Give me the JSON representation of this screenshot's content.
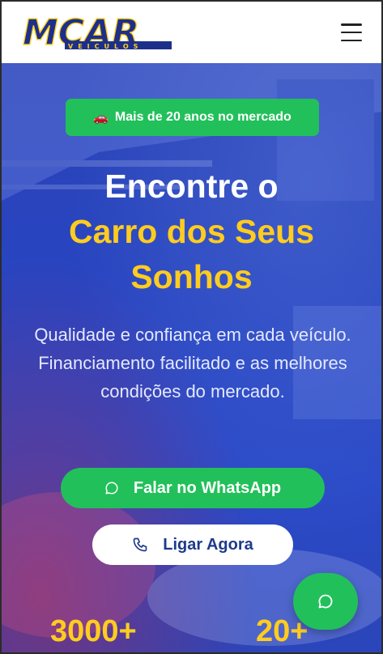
{
  "header": {
    "logo_text": "MCAR",
    "logo_subtext": "VEICULOS",
    "menu_icon": "hamburger-menu-icon"
  },
  "hero": {
    "badge": {
      "icon": "car-icon",
      "label": "Mais de 20 anos no mercado"
    },
    "headline": {
      "line1": "Encontre o",
      "line2": "Carro dos Seus",
      "line3": "Sonhos"
    },
    "subtitle": "Qualidade e confiança em cada veículo. Financiamento facilitado e as melhores condições do mercado.",
    "whatsapp_button": {
      "icon": "whatsapp-icon",
      "label": "Falar no WhatsApp"
    },
    "call_button": {
      "icon": "phone-icon",
      "label": "Ligar Agora"
    },
    "stats": [
      {
        "value": "3000+"
      },
      {
        "value": "20+"
      }
    ]
  },
  "floating_button": {
    "icon": "whatsapp-chat-icon"
  },
  "colors": {
    "brand_blue": "#1e3a8a",
    "accent_yellow": "#ffcc1f",
    "whatsapp_green": "#22c05a",
    "hero_blue": "#2845c2"
  }
}
